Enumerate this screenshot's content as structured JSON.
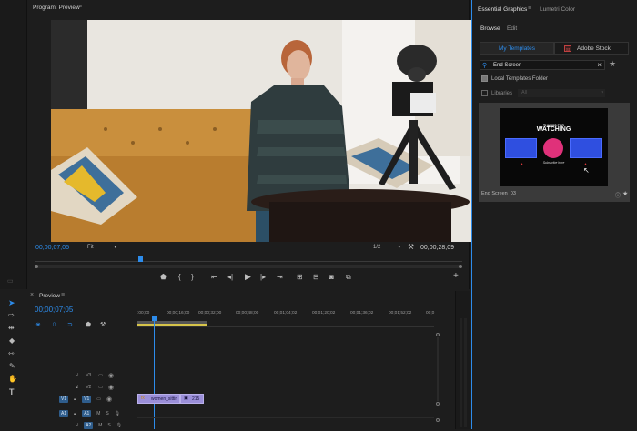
{
  "program": {
    "title": "Program: Preview",
    "timecode_current": "00;00;07;05",
    "timecode_duration": "00;00;28;09",
    "fit": "Fit",
    "resolution": "1/2"
  },
  "essential_graphics": {
    "tab_active": "Essential Graphics",
    "tab_other": "Lumetri Color",
    "subtab_browse": "Browse",
    "subtab_edit": "Edit",
    "btn_my_templates": "My Templates",
    "btn_adobe_stock": "Adobe Stock",
    "stock_badge": "St",
    "search_value": "End Screen",
    "check_local": "Local Templates Folder",
    "check_libraries": "Libraries",
    "libraries_select": "All",
    "template_name": "End Screen_03",
    "thumb_line1": "THANKS FOR",
    "thumb_line2": "WATCHING",
    "thumb_sub": "Subscribe here"
  },
  "timeline": {
    "title": "Preview",
    "timecode": "00;00;07;05",
    "ruler": [
      ":00;00",
      "00;00;16;00",
      "00;00;32;00",
      "00;00;48;00",
      "00;01;04;02",
      "00;01;20;02",
      "00;01;36;02",
      "00;01;52;02",
      "00;0"
    ],
    "tracks": [
      {
        "label": "V3",
        "kind": "video"
      },
      {
        "label": "V2",
        "kind": "video"
      },
      {
        "label": "V1",
        "kind": "video",
        "source": "V1"
      },
      {
        "label": "A1",
        "kind": "audio",
        "source": "A1"
      },
      {
        "label": "A2",
        "kind": "audio"
      }
    ],
    "clip_video_name": "women_sittin",
    "clip_graphic_name": "215",
    "btn_m": "M",
    "btn_s": "S"
  },
  "tools": [
    "selection-tool",
    "track-select-tool",
    "ripple-edit-tool",
    "razor-tool",
    "slip-tool",
    "pen-tool",
    "hand-tool",
    "type-tool"
  ],
  "colors": {
    "accent": "#2d8ceb",
    "clip_video": "#9b8fd9",
    "clip_audio_bar": "#d6c44a",
    "thumb_circle": "#e0317a",
    "thumb_box": "#2f4fe0"
  }
}
